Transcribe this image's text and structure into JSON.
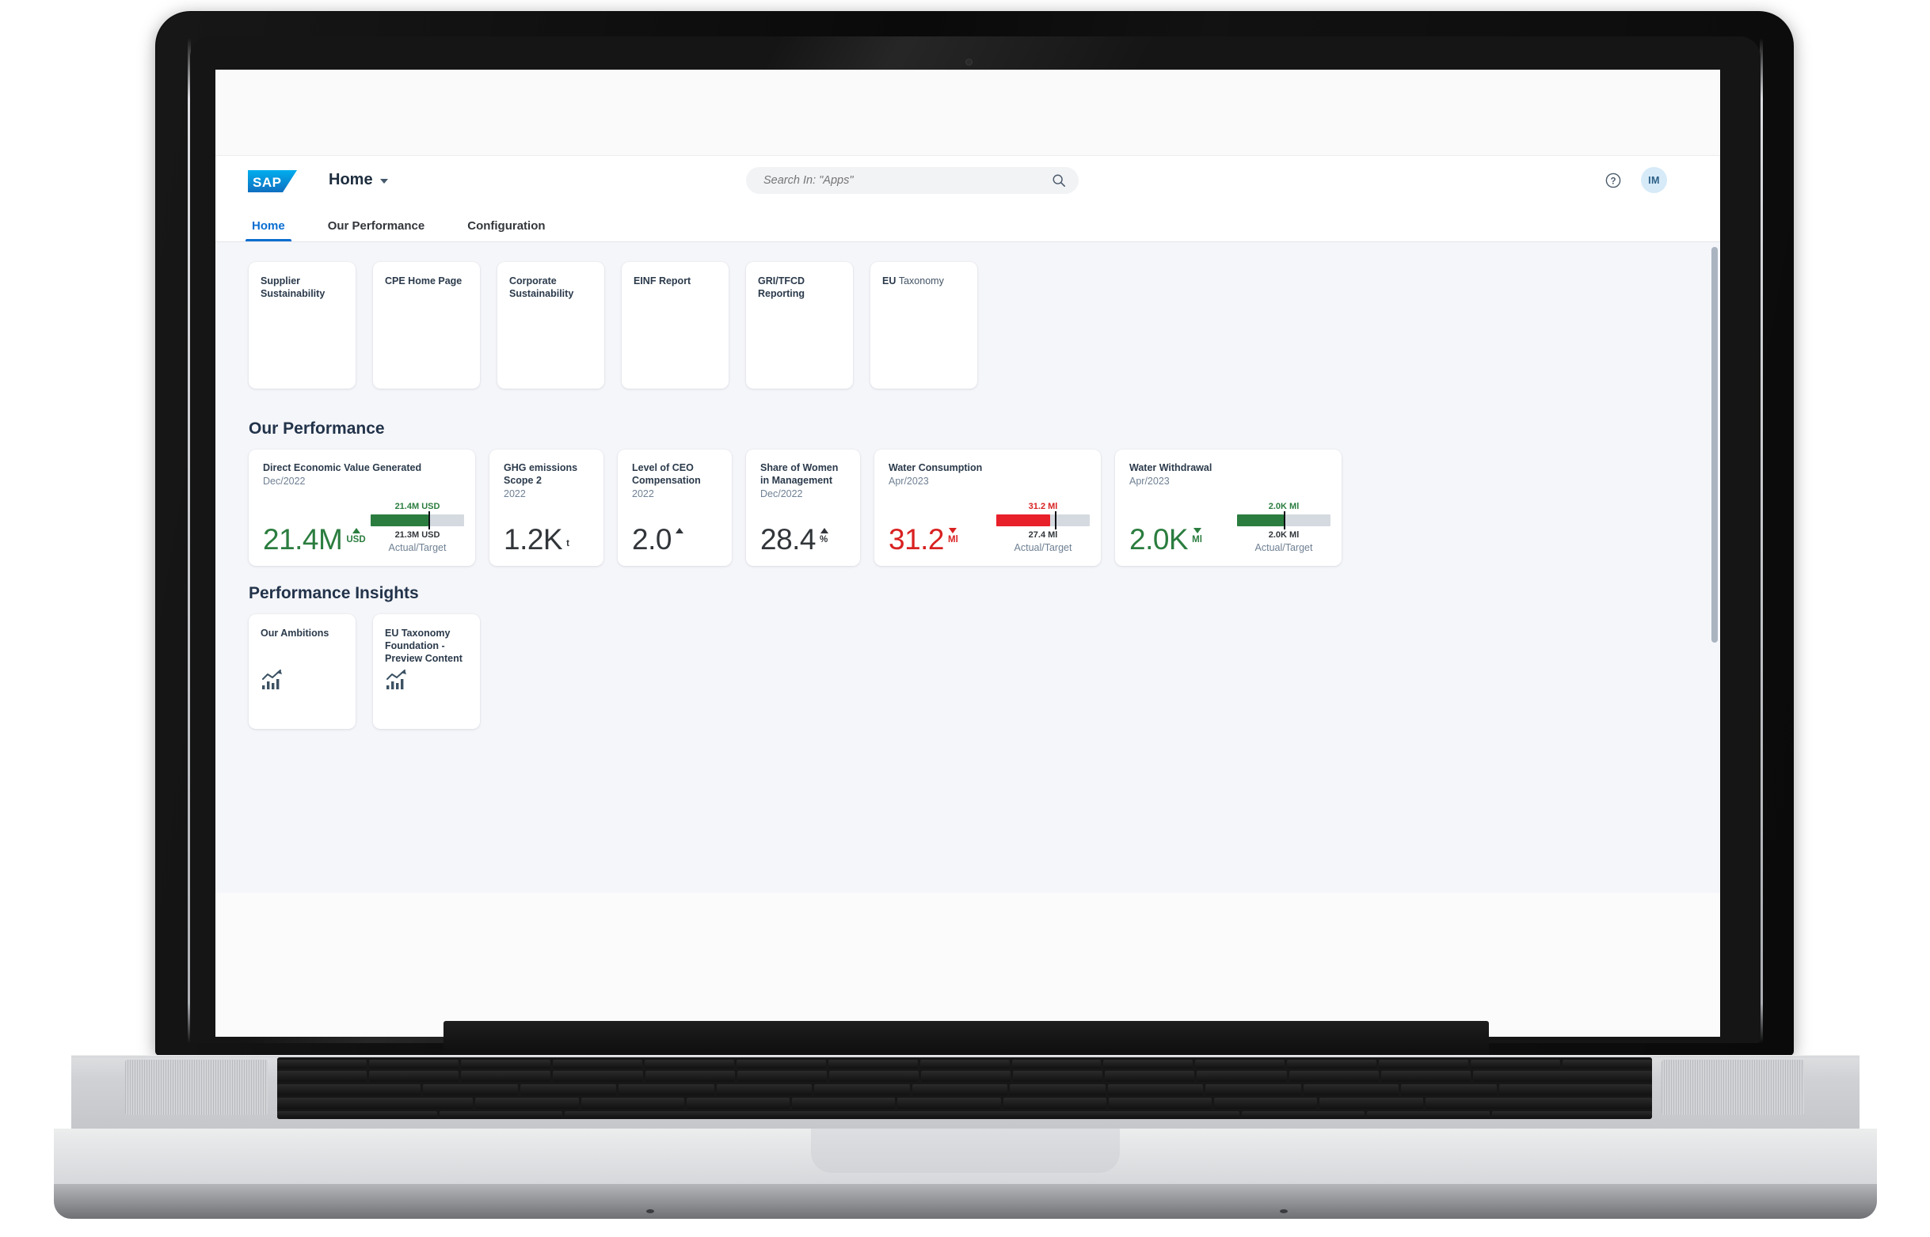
{
  "shell": {
    "logo_text": "SAP",
    "title": "Home",
    "chevron_icon": "chevron-down-icon",
    "search": {
      "placeholder": "Search In: \"Apps\"",
      "value": "",
      "icon": "search-icon"
    },
    "help_icon": "question-mark-circle-icon",
    "avatar_initials": "IM"
  },
  "tabs": [
    {
      "label": "Home",
      "active": true
    },
    {
      "label": "Our Performance",
      "active": false
    },
    {
      "label": "Configuration",
      "active": false
    }
  ],
  "app_tiles": [
    {
      "title": "Supplier Sustainability"
    },
    {
      "title": "CPE Home Page"
    },
    {
      "title": "Corporate Sustainability"
    },
    {
      "title": "EINF Report"
    },
    {
      "title": "GRI/TFCD Reporting"
    },
    {
      "title_bold": "EU",
      "title_light": "Taxonomy"
    }
  ],
  "sections": {
    "our_performance": "Our Performance",
    "performance_insights": "Performance Insights"
  },
  "colors": {
    "positive": "#2b7d3f",
    "negative": "#d92121",
    "neutral": "#32363a",
    "accent": "#0a6ed1",
    "track": "#d5dae0",
    "page_bg": "#f5f6fa"
  },
  "kpis": [
    {
      "title": "Direct Economic Value Generated",
      "period": "Dec/2022",
      "value": "21.4M",
      "unit": "USD",
      "trend": "up",
      "status": "positive",
      "bullet": {
        "actual_label": "21.4M USD",
        "target_label": "21.3M USD",
        "caption": "Actual/Target",
        "fill_pct": 62,
        "marker_pct": 62,
        "fill_color": "#2b7d3f"
      }
    },
    {
      "title": "GHG emissions Scope 2",
      "period": "2022",
      "value": "1.2K",
      "unit": "t",
      "trend": "none",
      "status": "neutral"
    },
    {
      "title": "Level of CEO Compensation",
      "period": "2022",
      "value": "2.0",
      "unit": "",
      "trend": "up",
      "status": "neutral"
    },
    {
      "title": "Share of Women in Management",
      "period": "Dec/2022",
      "value": "28.4",
      "unit": "%",
      "trend": "up",
      "status": "neutral"
    },
    {
      "title": "Water Consumption",
      "period": "Apr/2023",
      "value": "31.2",
      "unit": "Ml",
      "trend": "down",
      "status": "negative",
      "bullet": {
        "actual_label": "31.2 Ml",
        "target_label": "27.4 Ml",
        "caption": "Actual/Target",
        "fill_pct": 58,
        "marker_pct": 63,
        "fill_color": "#e8202a"
      }
    },
    {
      "title": "Water Withdrawal",
      "period": "Apr/2023",
      "value": "2.0K",
      "unit": "Ml",
      "trend": "down",
      "status": "positive",
      "bullet": {
        "actual_label": "2.0K Ml",
        "target_label": "2.0K Ml",
        "caption": "Actual/Target",
        "fill_pct": 50,
        "marker_pct": 50,
        "fill_color": "#2b7d3f"
      }
    }
  ],
  "insight_tiles": [
    {
      "title": "Our Ambitions",
      "icon": "bar-chart-trend-icon"
    },
    {
      "title": "EU Taxonomy Foundation - Preview Content",
      "icon": "bar-chart-trend-icon"
    }
  ],
  "chart_data": [
    {
      "type": "bar",
      "title": "Direct Economic Value Generated",
      "subtitle": "Dec/2022",
      "categories": [
        "Actual",
        "Target"
      ],
      "values": [
        21400000,
        21300000
      ],
      "value_labels": [
        "21.4M USD",
        "21.3M USD"
      ],
      "unit": "USD",
      "xlabel": "",
      "ylabel": "Actual/Target",
      "series": [
        {
          "name": "Actual/Target",
          "values": [
            21400000,
            21300000
          ]
        }
      ],
      "legend": "none",
      "grid": false
    },
    {
      "type": "bar",
      "title": "Water Consumption",
      "subtitle": "Apr/2023",
      "categories": [
        "Actual",
        "Target"
      ],
      "values": [
        31.2,
        27.4
      ],
      "value_labels": [
        "31.2 Ml",
        "27.4 Ml"
      ],
      "unit": "Ml",
      "xlabel": "",
      "ylabel": "Actual/Target",
      "series": [
        {
          "name": "Actual/Target",
          "values": [
            31.2,
            27.4
          ]
        }
      ],
      "legend": "none",
      "grid": false
    },
    {
      "type": "bar",
      "title": "Water Withdrawal",
      "subtitle": "Apr/2023",
      "categories": [
        "Actual",
        "Target"
      ],
      "values": [
        2000,
        2000
      ],
      "value_labels": [
        "2.0K Ml",
        "2.0K Ml"
      ],
      "unit": "Ml",
      "xlabel": "",
      "ylabel": "Actual/Target",
      "series": [
        {
          "name": "Actual/Target",
          "values": [
            2000,
            2000
          ]
        }
      ],
      "legend": "none",
      "grid": false
    }
  ]
}
